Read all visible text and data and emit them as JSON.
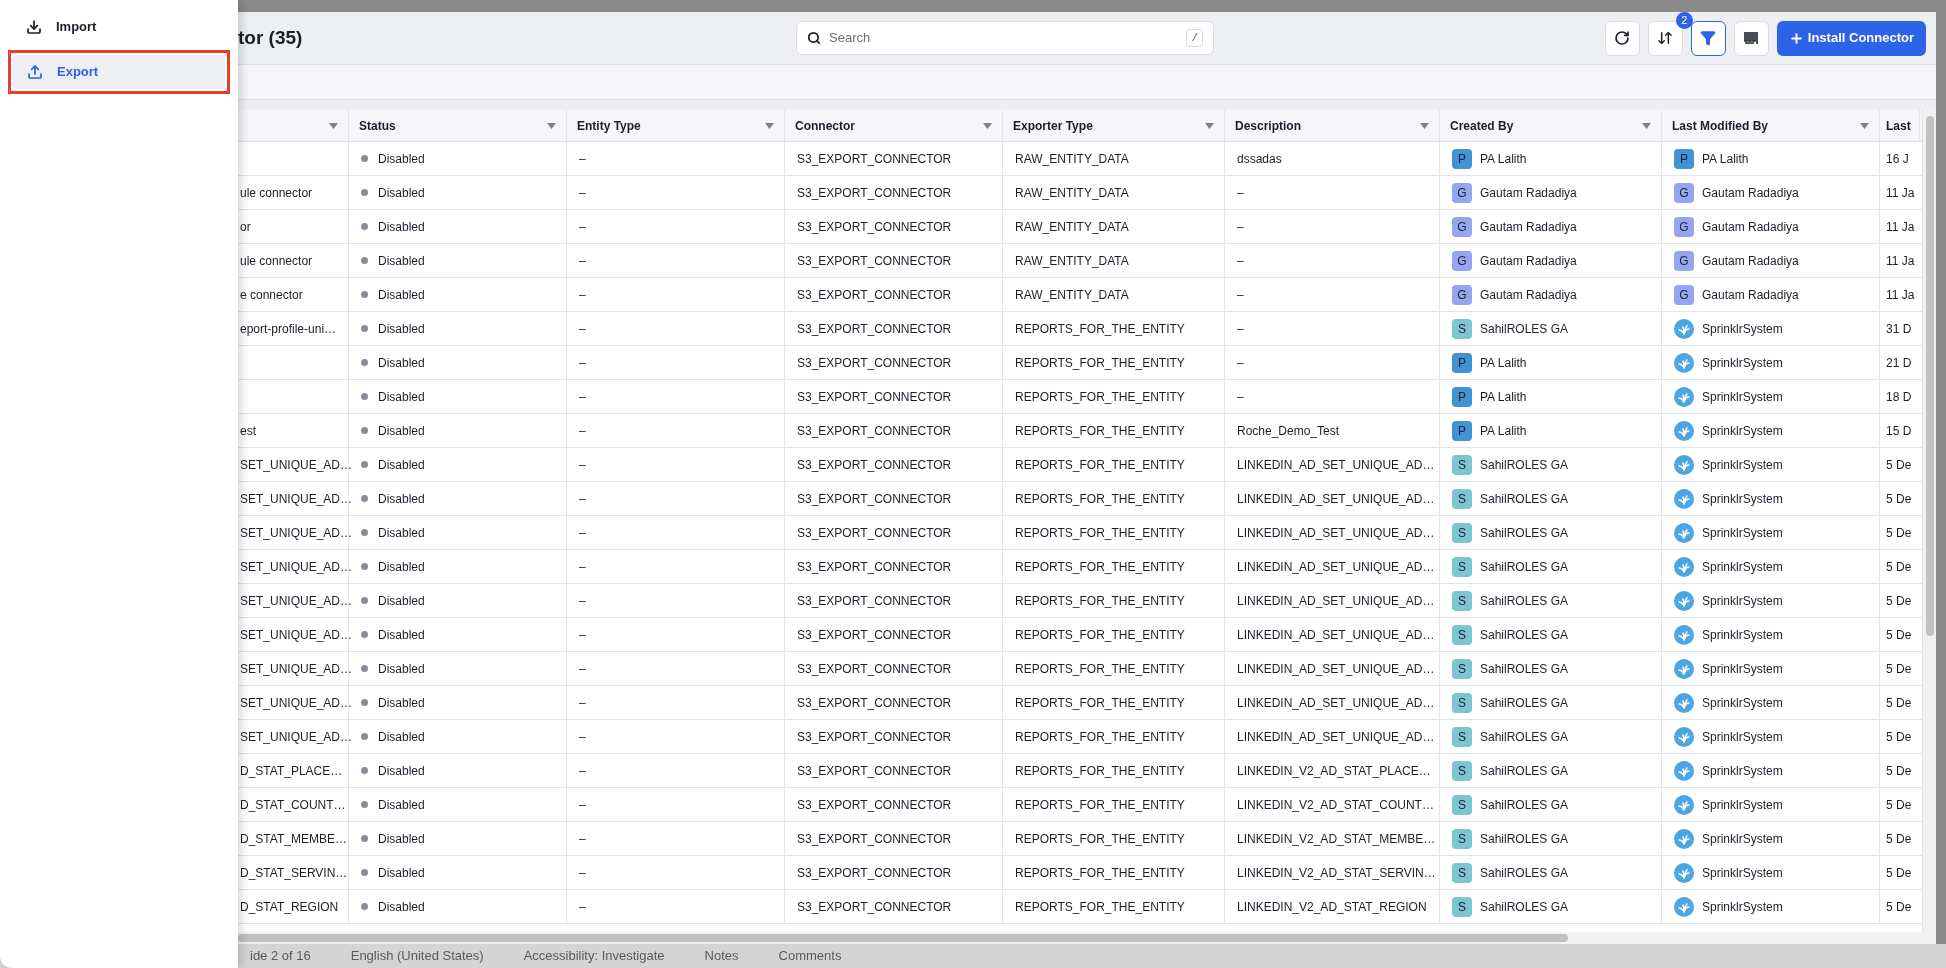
{
  "menu": {
    "items": [
      {
        "label": "Import",
        "selected": false
      },
      {
        "label": "Export",
        "selected": true,
        "highlighted": true
      }
    ]
  },
  "header": {
    "title": "tor (35)",
    "search": {
      "placeholder": "Search",
      "shortcut": "/"
    },
    "filter_count": "2",
    "filter_active": true,
    "install_button": "Install Connector"
  },
  "table": {
    "columns": [
      "Status",
      "Entity Type",
      "Connector",
      "Exporter Type",
      "Description",
      "Created By",
      "Last Modified By",
      "Last"
    ],
    "rows": [
      {
        "name": "",
        "status": "Disabled",
        "entity_type": "–",
        "connector": "S3_EXPORT_CONNECTOR",
        "exporter_type": "RAW_ENTITY_DATA",
        "description": "dssadas",
        "created_by": {
          "kind": "user",
          "initial": "P",
          "name": "PA Lalith",
          "color": "#3f94d1"
        },
        "last_modified_by": {
          "kind": "user",
          "initial": "P",
          "name": "PA Lalith",
          "color": "#3f94d1"
        },
        "column_9": "16 J"
      },
      {
        "name": "ule connector",
        "status": "Disabled",
        "entity_type": "–",
        "connector": "S3_EXPORT_CONNECTOR",
        "exporter_type": "RAW_ENTITY_DATA",
        "description": "–",
        "created_by": {
          "kind": "user",
          "initial": "G",
          "name": "Gautam Radadiya",
          "color": "#93a6ee"
        },
        "last_modified_by": {
          "kind": "user",
          "initial": "G",
          "name": "Gautam Radadiya",
          "color": "#93a6ee"
        },
        "column_9": "11 Ja"
      },
      {
        "name": "or",
        "status": "Disabled",
        "entity_type": "–",
        "connector": "S3_EXPORT_CONNECTOR",
        "exporter_type": "RAW_ENTITY_DATA",
        "description": "–",
        "created_by": {
          "kind": "user",
          "initial": "G",
          "name": "Gautam Radadiya",
          "color": "#93a6ee"
        },
        "last_modified_by": {
          "kind": "user",
          "initial": "G",
          "name": "Gautam Radadiya",
          "color": "#93a6ee"
        },
        "column_9": "11 Ja"
      },
      {
        "name": "ule connector",
        "status": "Disabled",
        "entity_type": "–",
        "connector": "S3_EXPORT_CONNECTOR",
        "exporter_type": "RAW_ENTITY_DATA",
        "description": "–",
        "created_by": {
          "kind": "user",
          "initial": "G",
          "name": "Gautam Radadiya",
          "color": "#93a6ee"
        },
        "last_modified_by": {
          "kind": "user",
          "initial": "G",
          "name": "Gautam Radadiya",
          "color": "#93a6ee"
        },
        "column_9": "11 Ja"
      },
      {
        "name": "e connector",
        "status": "Disabled",
        "entity_type": "–",
        "connector": "S3_EXPORT_CONNECTOR",
        "exporter_type": "RAW_ENTITY_DATA",
        "description": "–",
        "created_by": {
          "kind": "user",
          "initial": "G",
          "name": "Gautam Radadiya",
          "color": "#93a6ee"
        },
        "last_modified_by": {
          "kind": "user",
          "initial": "G",
          "name": "Gautam Radadiya",
          "color": "#93a6ee"
        },
        "column_9": "11 Ja"
      },
      {
        "name": "eport-profile-uni…",
        "status": "Disabled",
        "entity_type": "–",
        "connector": "S3_EXPORT_CONNECTOR",
        "exporter_type": "REPORTS_FOR_THE_ENTITY",
        "description": "–",
        "created_by": {
          "kind": "user",
          "initial": "S",
          "name": "SahilROLES GA",
          "color": "#7cc5d3"
        },
        "last_modified_by": {
          "kind": "system",
          "name": "SprinklrSystem"
        },
        "column_9": "31 D"
      },
      {
        "name": "",
        "status": "Disabled",
        "entity_type": "–",
        "connector": "S3_EXPORT_CONNECTOR",
        "exporter_type": "REPORTS_FOR_THE_ENTITY",
        "description": "–",
        "created_by": {
          "kind": "user",
          "initial": "P",
          "name": "PA Lalith",
          "color": "#3f94d1"
        },
        "last_modified_by": {
          "kind": "system",
          "name": "SprinklrSystem"
        },
        "column_9": "21 D"
      },
      {
        "name": "",
        "status": "Disabled",
        "entity_type": "–",
        "connector": "S3_EXPORT_CONNECTOR",
        "exporter_type": "REPORTS_FOR_THE_ENTITY",
        "description": "–",
        "created_by": {
          "kind": "user",
          "initial": "P",
          "name": "PA Lalith",
          "color": "#3f94d1"
        },
        "last_modified_by": {
          "kind": "system",
          "name": "SprinklrSystem"
        },
        "column_9": "18 D"
      },
      {
        "name": "est",
        "status": "Disabled",
        "entity_type": "–",
        "connector": "S3_EXPORT_CONNECTOR",
        "exporter_type": "REPORTS_FOR_THE_ENTITY",
        "description": "Roche_Demo_Test",
        "created_by": {
          "kind": "user",
          "initial": "P",
          "name": "PA Lalith",
          "color": "#3f94d1"
        },
        "last_modified_by": {
          "kind": "system",
          "name": "SprinklrSystem"
        },
        "column_9": "15 D"
      },
      {
        "name": "SET_UNIQUE_AD…",
        "status": "Disabled",
        "entity_type": "–",
        "connector": "S3_EXPORT_CONNECTOR",
        "exporter_type": "REPORTS_FOR_THE_ENTITY",
        "description": "LINKEDIN_AD_SET_UNIQUE_AD…",
        "created_by": {
          "kind": "user",
          "initial": "S",
          "name": "SahilROLES GA",
          "color": "#7cc5d3"
        },
        "last_modified_by": {
          "kind": "system",
          "name": "SprinklrSystem"
        },
        "column_9": "5 De"
      },
      {
        "name": "SET_UNIQUE_AD…",
        "status": "Disabled",
        "entity_type": "–",
        "connector": "S3_EXPORT_CONNECTOR",
        "exporter_type": "REPORTS_FOR_THE_ENTITY",
        "description": "LINKEDIN_AD_SET_UNIQUE_AD…",
        "created_by": {
          "kind": "user",
          "initial": "S",
          "name": "SahilROLES GA",
          "color": "#7cc5d3"
        },
        "last_modified_by": {
          "kind": "system",
          "name": "SprinklrSystem"
        },
        "column_9": "5 De"
      },
      {
        "name": "SET_UNIQUE_AD…",
        "status": "Disabled",
        "entity_type": "–",
        "connector": "S3_EXPORT_CONNECTOR",
        "exporter_type": "REPORTS_FOR_THE_ENTITY",
        "description": "LINKEDIN_AD_SET_UNIQUE_AD…",
        "created_by": {
          "kind": "user",
          "initial": "S",
          "name": "SahilROLES GA",
          "color": "#7cc5d3"
        },
        "last_modified_by": {
          "kind": "system",
          "name": "SprinklrSystem"
        },
        "column_9": "5 De"
      },
      {
        "name": "SET_UNIQUE_AD…",
        "status": "Disabled",
        "entity_type": "–",
        "connector": "S3_EXPORT_CONNECTOR",
        "exporter_type": "REPORTS_FOR_THE_ENTITY",
        "description": "LINKEDIN_AD_SET_UNIQUE_AD…",
        "created_by": {
          "kind": "user",
          "initial": "S",
          "name": "SahilROLES GA",
          "color": "#7cc5d3"
        },
        "last_modified_by": {
          "kind": "system",
          "name": "SprinklrSystem"
        },
        "column_9": "5 De"
      },
      {
        "name": "SET_UNIQUE_AD…",
        "status": "Disabled",
        "entity_type": "–",
        "connector": "S3_EXPORT_CONNECTOR",
        "exporter_type": "REPORTS_FOR_THE_ENTITY",
        "description": "LINKEDIN_AD_SET_UNIQUE_AD…",
        "created_by": {
          "kind": "user",
          "initial": "S",
          "name": "SahilROLES GA",
          "color": "#7cc5d3"
        },
        "last_modified_by": {
          "kind": "system",
          "name": "SprinklrSystem"
        },
        "column_9": "5 De"
      },
      {
        "name": "SET_UNIQUE_AD…",
        "status": "Disabled",
        "entity_type": "–",
        "connector": "S3_EXPORT_CONNECTOR",
        "exporter_type": "REPORTS_FOR_THE_ENTITY",
        "description": "LINKEDIN_AD_SET_UNIQUE_AD…",
        "created_by": {
          "kind": "user",
          "initial": "S",
          "name": "SahilROLES GA",
          "color": "#7cc5d3"
        },
        "last_modified_by": {
          "kind": "system",
          "name": "SprinklrSystem"
        },
        "column_9": "5 De"
      },
      {
        "name": "SET_UNIQUE_AD…",
        "status": "Disabled",
        "entity_type": "–",
        "connector": "S3_EXPORT_CONNECTOR",
        "exporter_type": "REPORTS_FOR_THE_ENTITY",
        "description": "LINKEDIN_AD_SET_UNIQUE_AD…",
        "created_by": {
          "kind": "user",
          "initial": "S",
          "name": "SahilROLES GA",
          "color": "#7cc5d3"
        },
        "last_modified_by": {
          "kind": "system",
          "name": "SprinklrSystem"
        },
        "column_9": "5 De"
      },
      {
        "name": "SET_UNIQUE_AD…",
        "status": "Disabled",
        "entity_type": "–",
        "connector": "S3_EXPORT_CONNECTOR",
        "exporter_type": "REPORTS_FOR_THE_ENTITY",
        "description": "LINKEDIN_AD_SET_UNIQUE_AD…",
        "created_by": {
          "kind": "user",
          "initial": "S",
          "name": "SahilROLES GA",
          "color": "#7cc5d3"
        },
        "last_modified_by": {
          "kind": "system",
          "name": "SprinklrSystem"
        },
        "column_9": "5 De"
      },
      {
        "name": "SET_UNIQUE_AD…",
        "status": "Disabled",
        "entity_type": "–",
        "connector": "S3_EXPORT_CONNECTOR",
        "exporter_type": "REPORTS_FOR_THE_ENTITY",
        "description": "LINKEDIN_AD_SET_UNIQUE_AD…",
        "created_by": {
          "kind": "user",
          "initial": "S",
          "name": "SahilROLES GA",
          "color": "#7cc5d3"
        },
        "last_modified_by": {
          "kind": "system",
          "name": "SprinklrSystem"
        },
        "column_9": "5 De"
      },
      {
        "name": "D_STAT_PLACE…",
        "status": "Disabled",
        "entity_type": "–",
        "connector": "S3_EXPORT_CONNECTOR",
        "exporter_type": "REPORTS_FOR_THE_ENTITY",
        "description": "LINKEDIN_V2_AD_STAT_PLACE…",
        "created_by": {
          "kind": "user",
          "initial": "S",
          "name": "SahilROLES GA",
          "color": "#7cc5d3"
        },
        "last_modified_by": {
          "kind": "system",
          "name": "SprinklrSystem"
        },
        "column_9": "5 De"
      },
      {
        "name": "D_STAT_COUNT…",
        "status": "Disabled",
        "entity_type": "–",
        "connector": "S3_EXPORT_CONNECTOR",
        "exporter_type": "REPORTS_FOR_THE_ENTITY",
        "description": "LINKEDIN_V2_AD_STAT_COUNT…",
        "created_by": {
          "kind": "user",
          "initial": "S",
          "name": "SahilROLES GA",
          "color": "#7cc5d3"
        },
        "last_modified_by": {
          "kind": "system",
          "name": "SprinklrSystem"
        },
        "column_9": "5 De"
      },
      {
        "name": "D_STAT_MEMBE…",
        "status": "Disabled",
        "entity_type": "–",
        "connector": "S3_EXPORT_CONNECTOR",
        "exporter_type": "REPORTS_FOR_THE_ENTITY",
        "description": "LINKEDIN_V2_AD_STAT_MEMBE…",
        "created_by": {
          "kind": "user",
          "initial": "S",
          "name": "SahilROLES GA",
          "color": "#7cc5d3"
        },
        "last_modified_by": {
          "kind": "system",
          "name": "SprinklrSystem"
        },
        "column_9": "5 De"
      },
      {
        "name": "D_STAT_SERVIN…",
        "status": "Disabled",
        "entity_type": "–",
        "connector": "S3_EXPORT_CONNECTOR",
        "exporter_type": "REPORTS_FOR_THE_ENTITY",
        "description": "LINKEDIN_V2_AD_STAT_SERVIN…",
        "created_by": {
          "kind": "user",
          "initial": "S",
          "name": "SahilROLES GA",
          "color": "#7cc5d3"
        },
        "last_modified_by": {
          "kind": "system",
          "name": "SprinklrSystem"
        },
        "column_9": "5 De"
      },
      {
        "name": "D_STAT_REGION",
        "status": "Disabled",
        "entity_type": "–",
        "connector": "S3_EXPORT_CONNECTOR",
        "exporter_type": "REPORTS_FOR_THE_ENTITY",
        "description": "LINKEDIN_V2_AD_STAT_REGION",
        "created_by": {
          "kind": "user",
          "initial": "S",
          "name": "SahilROLES GA",
          "color": "#7cc5d3"
        },
        "last_modified_by": {
          "kind": "system",
          "name": "SprinklrSystem"
        },
        "column_9": "5 De"
      }
    ]
  },
  "status_bar": [
    "ide 2 of 16",
    "English (United States)",
    "Accessibility: Investigate",
    "Notes",
    "Comments"
  ]
}
